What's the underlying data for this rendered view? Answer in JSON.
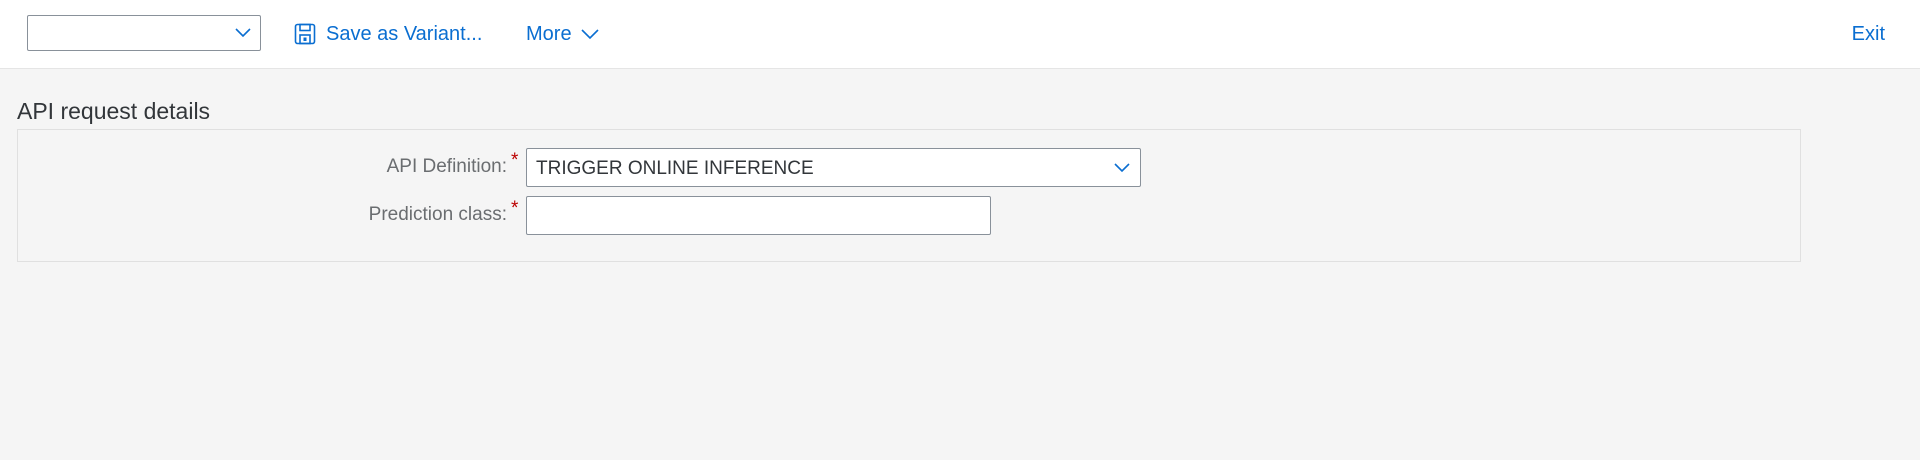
{
  "toolbar": {
    "variant_select_value": "",
    "save_variant_label": "Save as Variant...",
    "more_label": "More",
    "exit_label": "Exit",
    "accent_color": "#0a6ed1"
  },
  "section": {
    "title": "API request details"
  },
  "form": {
    "api_definition": {
      "label": "API Definition:",
      "required_mark": "*",
      "value": "TRIGGER ONLINE INFERENCE"
    },
    "prediction_class": {
      "label": "Prediction class:",
      "required_mark": "*",
      "value": "",
      "placeholder": ""
    }
  },
  "icons": {
    "variant_chevron": "chevron-down-icon",
    "save": "save-icon",
    "more_chevron": "chevron-down-icon",
    "api_chevron": "chevron-down-icon"
  }
}
